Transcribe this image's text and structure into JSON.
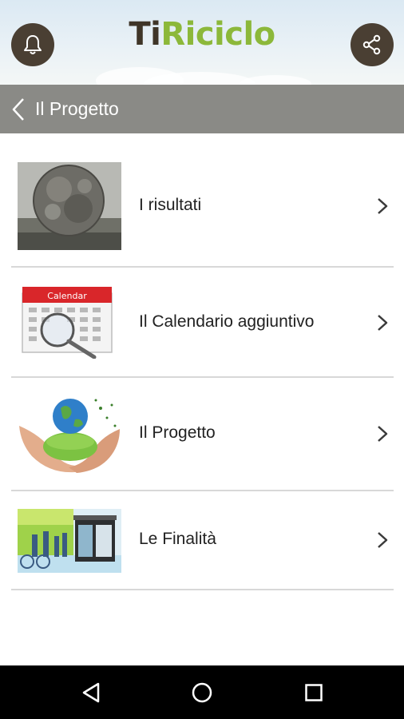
{
  "header": {
    "logo_ti": "Ti",
    "logo_riciclo": "Riciclo",
    "bell_icon": "bell-icon",
    "share_icon": "share-icon",
    "colors": {
      "button_bg": "#4a3f33",
      "logo_dark": "#3f3528",
      "logo_green": "#8cb83a"
    }
  },
  "subbar": {
    "title": "Il Progetto",
    "back_icon": "chevron-left-icon",
    "bg": "#8a8a86"
  },
  "items": [
    {
      "label": "I risultati",
      "image": "trash-sphere-image"
    },
    {
      "label": "Il Calendario aggiuntivo",
      "image": "calendar-image",
      "image_text": "Calendar"
    },
    {
      "label": "Il Progetto",
      "image": "hands-globe-image"
    },
    {
      "label": "Le Finalità",
      "image": "recycling-station-image"
    }
  ],
  "navbar": {
    "back": "nav-back-icon",
    "home": "nav-home-icon",
    "recents": "nav-recents-icon"
  }
}
